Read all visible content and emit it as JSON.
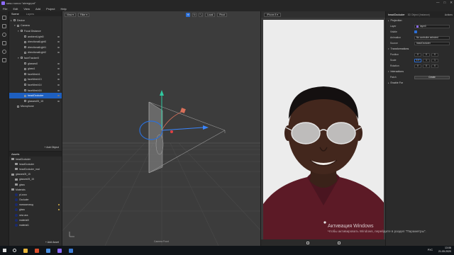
{
  "window": {
    "title": "sasu nonoo “ateegrpot”",
    "controls": [
      "—",
      "□",
      "✕"
    ]
  },
  "menu": [
    "File",
    "Edit",
    "View",
    "Add",
    "Project",
    "Help"
  ],
  "scene_panel": {
    "tabs": [
      "Scene",
      "Layers"
    ],
    "tree": [
      {
        "label": "Device",
        "depth": 0,
        "arrow": "▸",
        "selected": false
      },
      {
        "label": "Camera",
        "depth": 1,
        "arrow": "▾",
        "selected": false
      },
      {
        "label": "Focal Distance",
        "depth": 2,
        "arrow": "▾",
        "selected": false
      },
      {
        "label": "ambientLight0",
        "depth": 3,
        "arrow": "",
        "selected": false
      },
      {
        "label": "directionalLight0",
        "depth": 3,
        "arrow": "",
        "selected": false
      },
      {
        "label": "directionalLight1",
        "depth": 3,
        "arrow": "",
        "selected": false
      },
      {
        "label": "directionalLight2",
        "depth": 3,
        "arrow": "",
        "selected": false
      },
      {
        "label": "faceTracker0",
        "depth": 2,
        "arrow": "▾",
        "selected": false
      },
      {
        "label": "glasses0",
        "depth": 3,
        "arrow": "",
        "selected": false
      },
      {
        "label": "glass1",
        "depth": 3,
        "arrow": "",
        "selected": false
      },
      {
        "label": "faceMesh1",
        "depth": 3,
        "arrow": "",
        "selected": false
      },
      {
        "label": "faceMesh13",
        "depth": 3,
        "arrow": "",
        "selected": false
      },
      {
        "label": "faceMesh14",
        "depth": 3,
        "arrow": "",
        "selected": false
      },
      {
        "label": "faceMesh16",
        "depth": 3,
        "arrow": "",
        "selected": false
      },
      {
        "label": "headOccluder",
        "depth": 3,
        "arrow": "",
        "selected": true
      },
      {
        "label": "glasses05_15",
        "depth": 3,
        "arrow": "",
        "selected": false
      },
      {
        "label": "Microphone",
        "depth": 1,
        "arrow": "",
        "selected": false
      }
    ],
    "add_object": "+ Add Object"
  },
  "assets_panel": {
    "title": "Assets",
    "items": [
      {
        "label": "headOccluder",
        "kind": "folder",
        "depth": 0,
        "mark": false
      },
      {
        "label": "headOccluder",
        "kind": "folder",
        "depth": 1,
        "mark": false
      },
      {
        "label": "headOccluder_mat",
        "kind": "item",
        "depth": 1,
        "mark": false
      },
      {
        "label": "glasses05_15",
        "kind": "folder",
        "depth": 0,
        "mark": false
      },
      {
        "label": "glasses05_15",
        "kind": "item",
        "depth": 1,
        "mark": false
      },
      {
        "label": "glass",
        "kind": "item",
        "depth": 1,
        "mark": false
      },
      {
        "label": "Materials",
        "kind": "folder",
        "depth": 0,
        "mark": false
      },
      {
        "label": "pl-coco",
        "kind": "material",
        "depth": 1,
        "mark": false
      },
      {
        "label": "Occluder",
        "kind": "material",
        "depth": 1,
        "mark": false
      },
      {
        "label": "нанизатовод",
        "kind": "material",
        "depth": 1,
        "mark": true
      },
      {
        "label": "glass",
        "kind": "material",
        "depth": 1,
        "mark": true
      },
      {
        "label": "new ass",
        "kind": "material",
        "depth": 1,
        "mark": false
      },
      {
        "label": "material0",
        "kind": "material",
        "depth": 1,
        "mark": false
      },
      {
        "label": "material1",
        "kind": "material",
        "depth": 1,
        "mark": false
      }
    ],
    "add_asset": "+ Add Asset"
  },
  "viewport": {
    "toolbar": {
      "view": "View",
      "filter": "Filter",
      "local": "Local",
      "pivot": "Pivot"
    },
    "camera_label": "Camera Front"
  },
  "preview": {
    "device": "iPhone 8"
  },
  "inspector": {
    "object_name": "headOccluder",
    "object_type": "3D Object (Instance)",
    "actions_label": "Actions",
    "sections": {
      "projection": "Projection",
      "transformations": "Transformations",
      "interactions": "Interactions",
      "enable_for": "Enable For"
    },
    "rows": {
      "layer": {
        "label": "Layer",
        "value": "layer0"
      },
      "visible": {
        "label": "Visible"
      },
      "animation": {
        "label": "Animation",
        "value": "No controller selected"
      },
      "source": {
        "label": "Source",
        "value": "headOccluder"
      },
      "position": {
        "label": "Position",
        "values": [
          "0",
          "0",
          "0"
        ]
      },
      "scale": {
        "label": "Scale",
        "values": [
          "1.0",
          "1",
          "1"
        ]
      },
      "rotation": {
        "label": "Rotation",
        "values": [
          "0",
          "0",
          "0"
        ]
      },
      "patch": {
        "label": "Patch",
        "button": "Create"
      }
    }
  },
  "watermark": {
    "line1": "Активация Windows",
    "line2": "Чтобы активировать Windows, перейдите в раздел \"Параметры\"."
  },
  "taskbar": {
    "lang": "РУС",
    "time": "13:06",
    "date": "21.05.2020",
    "app_colors": [
      "#e8b63a",
      "#d94f2c",
      "#4a8fe0",
      "#8d6bff",
      "#3a7bd5"
    ]
  }
}
